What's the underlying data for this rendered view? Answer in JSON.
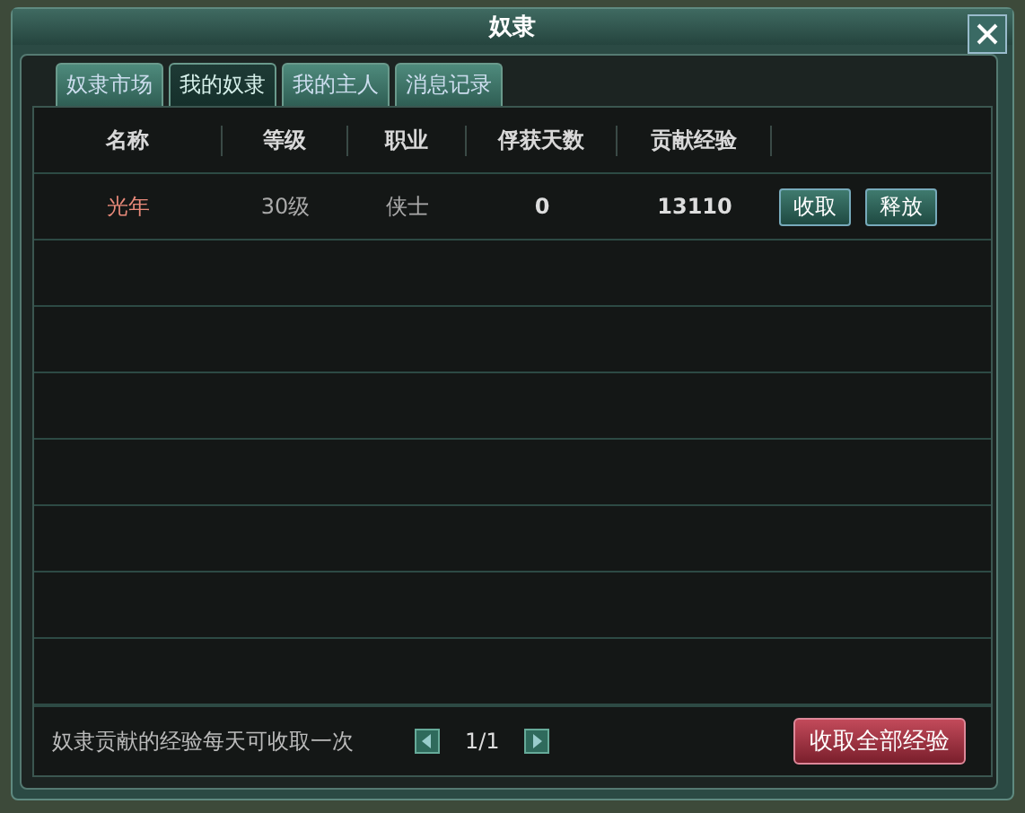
{
  "window": {
    "title": "奴隶"
  },
  "tabs": [
    {
      "label": "奴隶市场",
      "selected": false
    },
    {
      "label": "我的奴隶",
      "selected": true
    },
    {
      "label": "我的主人",
      "selected": false
    },
    {
      "label": "消息记录",
      "selected": false
    }
  ],
  "table": {
    "columns": [
      "名称",
      "等级",
      "职业",
      "俘获天数",
      "贡献经验"
    ],
    "rows": [
      {
        "cells": [
          "光年",
          "30级",
          "侠士",
          "0",
          "13110"
        ],
        "actions": [
          "收取",
          "释放"
        ]
      }
    ]
  },
  "footer": {
    "note": "奴隶贡献的经验每天可收取一次",
    "page": "1/1",
    "collect_all": "收取全部经验"
  }
}
